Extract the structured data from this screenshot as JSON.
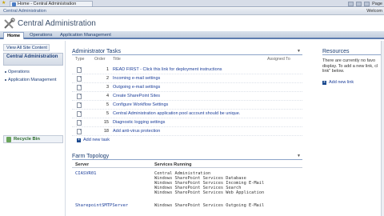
{
  "browser": {
    "tab_title": "Home - Central Administration",
    "page_menu": "Page"
  },
  "top": {
    "site_link": "Central Administration",
    "welcome": "Welcom"
  },
  "header": {
    "title": "Central Administration"
  },
  "tabs": [
    {
      "label": "Home"
    },
    {
      "label": "Operations"
    },
    {
      "label": "Application Management"
    }
  ],
  "leftnav": {
    "view_all": "View All Site Content",
    "section_title": "Central Administration",
    "items": [
      {
        "label": "Operations"
      },
      {
        "label": "Application Management"
      }
    ],
    "recycle": "Recycle Bin"
  },
  "tasks": {
    "title": "Administrator Tasks",
    "columns": {
      "type": "Type",
      "order": "Order",
      "title": "Title",
      "assigned": "Assigned To"
    },
    "rows": [
      {
        "order": "1",
        "title": "READ FIRST - Click this link for deployment instructions"
      },
      {
        "order": "2",
        "title": "Incoming e-mail settings"
      },
      {
        "order": "3",
        "title": "Outgoing e-mail settings"
      },
      {
        "order": "4",
        "title": "Create SharePoint Sites"
      },
      {
        "order": "5",
        "title": "Configure Workflow Settings"
      },
      {
        "order": "5",
        "title": "Central Administration application pool account should be unique."
      },
      {
        "order": "15",
        "title": "Diagnostic logging settings"
      },
      {
        "order": "18",
        "title": "Add anti-virus protection"
      }
    ],
    "add_label": "Add new task"
  },
  "resources": {
    "title": "Resources",
    "lines": [
      "There are currently no favo",
      "display. To add a new link, cl",
      "link\" below."
    ],
    "add_label": "Add new link"
  },
  "farm": {
    "title": "Farm Topology",
    "columns": {
      "server": "Server",
      "services": "Services Running"
    },
    "servers": [
      {
        "name": "CIASVR01",
        "services": [
          "Central Administration",
          "Windows SharePoint Services Database",
          "Windows SharePoint Services Incoming E-Mail",
          "Windows SharePoint Services Search",
          "Windows SharePoint Services Web Application"
        ]
      },
      {
        "name": "SharepointSMTPServer",
        "services": [
          "Windows SharePoint Services Outgoing E-Mail"
        ]
      }
    ]
  }
}
